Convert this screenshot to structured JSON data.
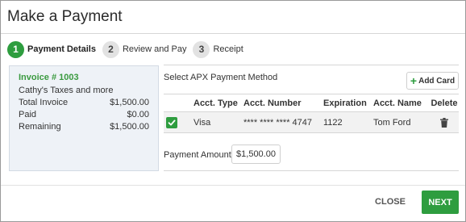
{
  "dialog": {
    "title": "Make a Payment"
  },
  "steps": [
    {
      "number": "1",
      "label": "Payment Details",
      "active": true
    },
    {
      "number": "2",
      "label": "Review and Pay",
      "active": false
    },
    {
      "number": "3",
      "label": "Receipt",
      "active": false
    }
  ],
  "invoice": {
    "number": "Invoice # 1003",
    "customer": "Cathy's Taxes and more",
    "rows": [
      {
        "label": "Total Invoice",
        "value": "$1,500.00"
      },
      {
        "label": "Paid",
        "value": "$0.00"
      },
      {
        "label": "Remaining",
        "value": "$1,500.00"
      }
    ]
  },
  "payment_method": {
    "heading": "Select APX Payment Method",
    "add_card_label": "Add Card",
    "columns": [
      "Acct. Type",
      "Acct. Number",
      "Expiration",
      "Acct. Name",
      "Delete"
    ],
    "cards": [
      {
        "selected": true,
        "type": "Visa",
        "number": "**** **** **** 4747",
        "expiration": "1122",
        "name": "Tom Ford"
      }
    ]
  },
  "payment_amount": {
    "label": "Payment Amount",
    "value": "$1,500.00"
  },
  "buttons": {
    "close": "CLOSE",
    "next": "NEXT"
  },
  "colors": {
    "accent": "#2e9d3f",
    "summary_bg": "#eef2f7"
  },
  "icons": {
    "add": "plus-icon",
    "selected": "checkmark-icon",
    "delete": "trash-icon"
  }
}
